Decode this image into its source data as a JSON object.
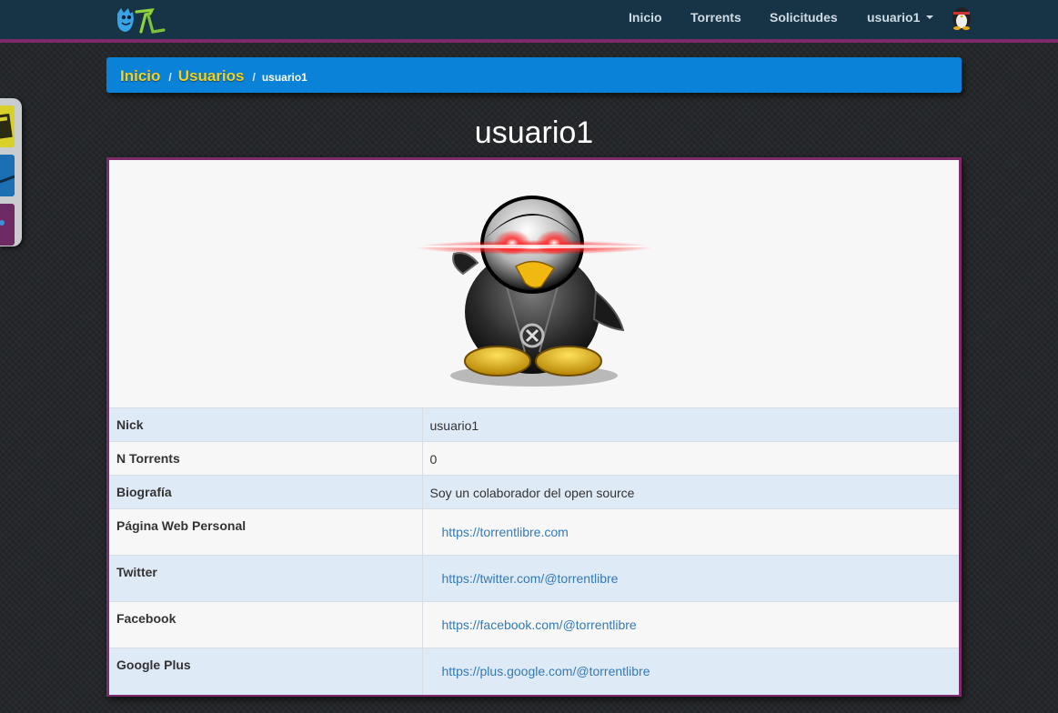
{
  "nav": {
    "items": [
      "Inicio",
      "Torrents",
      "Solicitudes"
    ],
    "user_menu": "usuario1"
  },
  "breadcrumb": {
    "home": "Inicio",
    "users": "Usuarios",
    "current": "usuario1"
  },
  "profile": {
    "title": "usuario1",
    "rows": [
      {
        "label": "Nick",
        "value": "usuario1"
      },
      {
        "label": "N Torrents",
        "value": "0"
      },
      {
        "label": "Biografía",
        "value": "Soy un colaborador del open source"
      },
      {
        "label": "Página Web Personal",
        "value": "https://torrentlibre.com"
      },
      {
        "label": "Twitter",
        "value": "https://twitter.com/@torrentlibre"
      },
      {
        "label": "Facebook",
        "value": "https://facebook.com/@torrentlibre"
      },
      {
        "label": "Google Plus",
        "value": "https://plus.google.com/@torrentlibre"
      }
    ]
  },
  "colors": {
    "navbar": "#173447",
    "accent_border": "#7d2a6d",
    "breadcrumb_bg": "#0a82d7",
    "breadcrumb_link": "#f2d021",
    "link": "#337ab7",
    "row_striped": "#dfeaf7"
  },
  "icons": {
    "brand": "torrentlibre-logo",
    "nav_avatar": "tux-avatar-icon",
    "side_widget": [
      "document-icon",
      "share-icon",
      "settings-icon"
    ],
    "profile_avatar": "tux-agent-laser-eyes"
  }
}
